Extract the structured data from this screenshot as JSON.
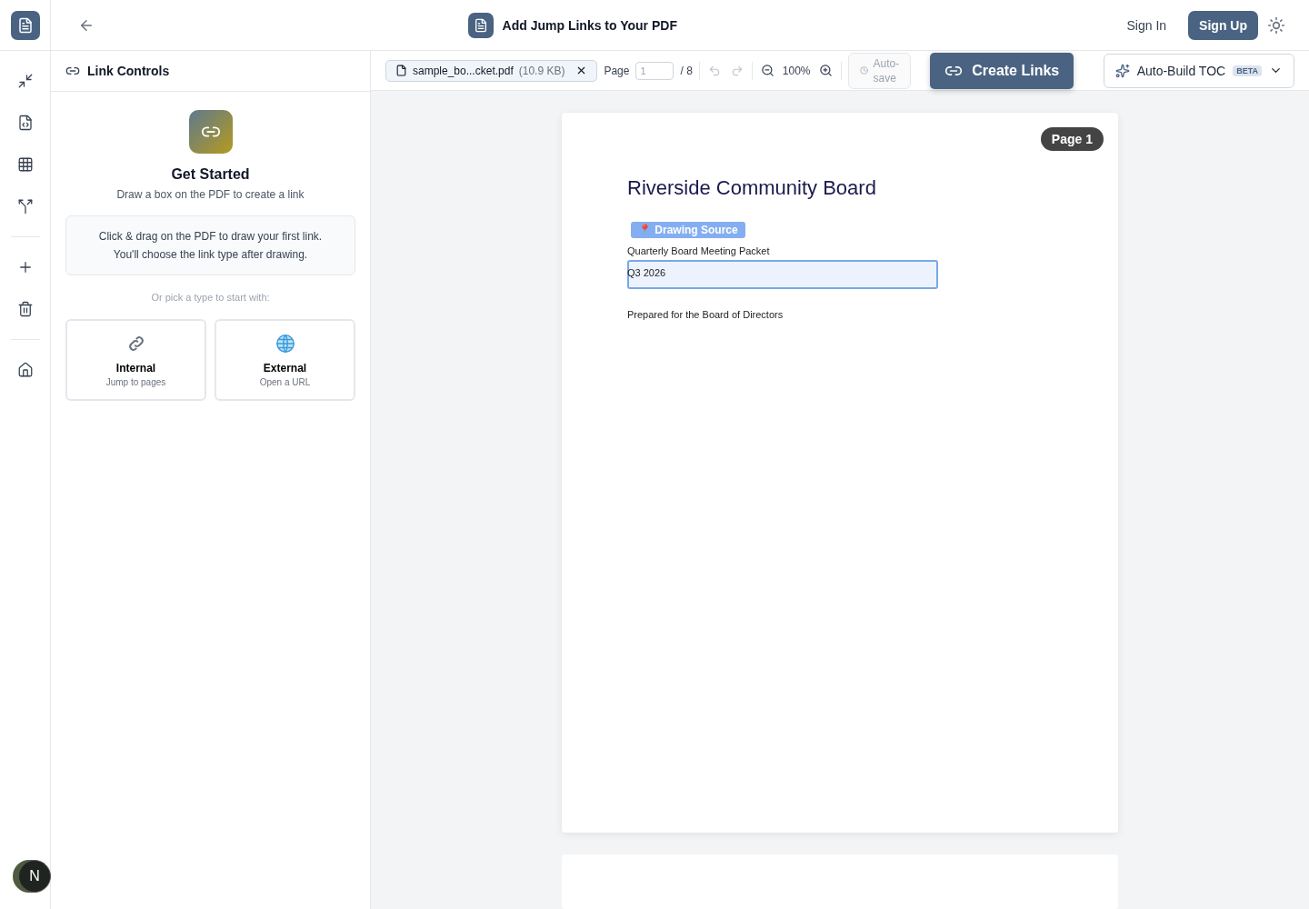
{
  "header": {
    "title": "Add Jump Links to Your PDF",
    "sign_in": "Sign In",
    "sign_up": "Sign Up"
  },
  "rail": {
    "tools": [
      {
        "kind": "minimize"
      },
      {
        "kind": "file-code"
      },
      {
        "kind": "grid"
      },
      {
        "kind": "split"
      },
      {
        "kind": "divider"
      },
      {
        "kind": "plus"
      },
      {
        "kind": "trash"
      },
      {
        "kind": "divider"
      },
      {
        "kind": "home"
      }
    ],
    "avatar": "N"
  },
  "panel": {
    "title": "Link Controls",
    "heading": "Get Started",
    "subtitle": "Draw a box on the PDF to create a link",
    "hint_lines": [
      "Click & drag on the PDF to draw your first link.",
      "You'll choose the link type after drawing."
    ],
    "pick_label": "Or pick a type to start with:",
    "types": [
      {
        "kind": "internal",
        "title": "Internal",
        "subtitle": "Jump to pages"
      },
      {
        "kind": "external",
        "title": "External",
        "subtitle": "Open a URL"
      }
    ]
  },
  "toolbar": {
    "file_name": "sample_bo...cket.pdf",
    "file_size": "(10.9 KB)",
    "page_label": "Page",
    "page_value": "1",
    "page_total": "/ 8",
    "zoom": "100%",
    "autosave": "Auto-\nsave",
    "create": "Create Links",
    "toc": "Auto-Build TOC",
    "toc_badge": "BETA"
  },
  "page": {
    "badge": "Page 1",
    "title": "Riverside Community Board",
    "lines": [
      "Quarterly Board Meeting Packet",
      "Q3 2026",
      "Prepared for the Board of Directors"
    ],
    "selection_label": "📍 Drawing Source"
  }
}
